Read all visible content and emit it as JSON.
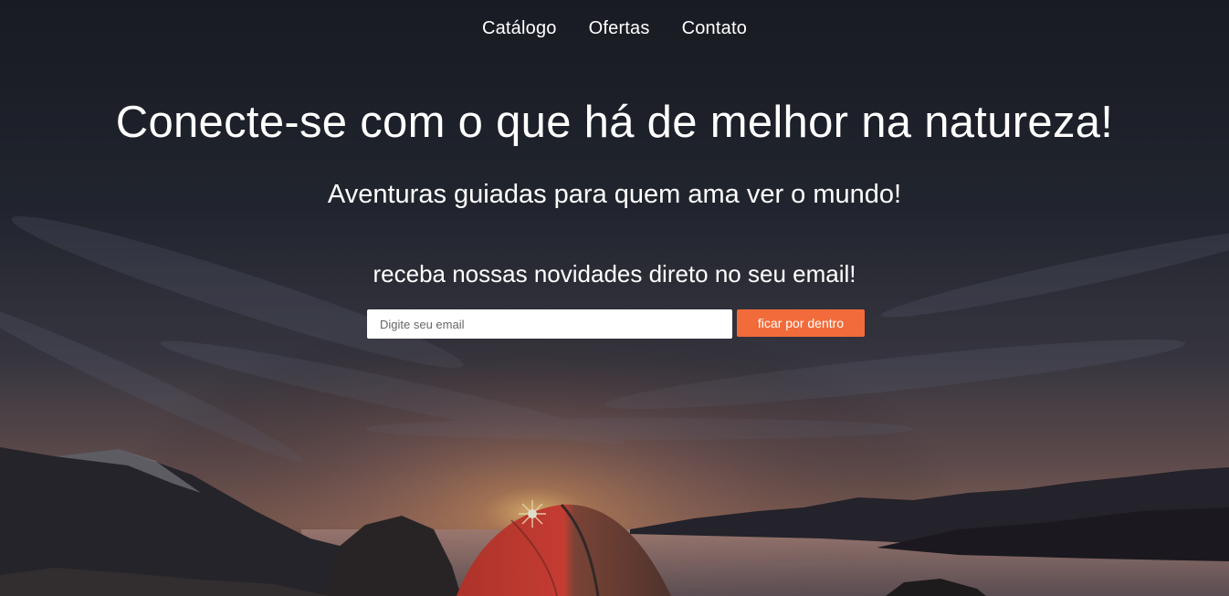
{
  "nav": {
    "items": [
      {
        "label": "Catálogo"
      },
      {
        "label": "Ofertas"
      },
      {
        "label": "Contato"
      }
    ]
  },
  "hero": {
    "headline": "Conecte-se com o que há de melhor na natureza!",
    "subheadline": "Aventuras guiadas para quem ama ver o mundo!"
  },
  "newsletter": {
    "prompt": "receba nossas novidades direto no seu email!",
    "email_placeholder": "Digite seu email",
    "email_value": "",
    "button_label": "ficar por dentro"
  },
  "colors": {
    "accent": "#f26b3a",
    "text": "#ffffff",
    "sky_dark": "#1d2029"
  }
}
